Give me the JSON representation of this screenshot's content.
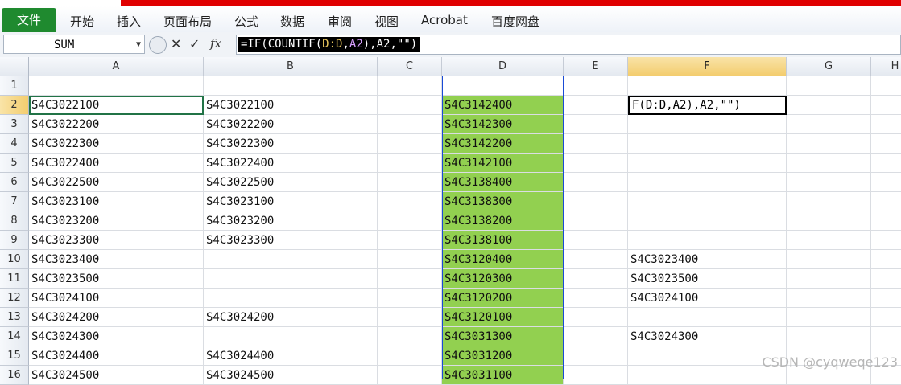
{
  "ribbon": {
    "file_tab": "文件",
    "tabs": [
      "开始",
      "插入",
      "页面布局",
      "公式",
      "数据",
      "审阅",
      "视图",
      "Acrobat",
      "百度网盘"
    ]
  },
  "formula_bar": {
    "name_box": "SUM",
    "cancel_icon": "✕",
    "enter_icon": "✓",
    "fx_icon": "fx",
    "formula_prefix": "=IF(COUNTIF(",
    "formula_ref1": "D:D",
    "formula_mid": ",",
    "formula_ref2": "A2",
    "formula_suffix": "),A2,\"\")"
  },
  "columns": [
    "A",
    "B",
    "C",
    "D",
    "E",
    "F",
    "G",
    "H"
  ],
  "rows": [
    {
      "n": "1",
      "A": "",
      "B": "",
      "D": "",
      "F": ""
    },
    {
      "n": "2",
      "A": "S4C3022100",
      "B": "S4C3022100",
      "D": "S4C3142400",
      "F": "F(D:D,A2),A2,\"\")"
    },
    {
      "n": "3",
      "A": "S4C3022200",
      "B": "S4C3022200",
      "D": "S4C3142300",
      "F": ""
    },
    {
      "n": "4",
      "A": "S4C3022300",
      "B": "S4C3022300",
      "D": "S4C3142200",
      "F": ""
    },
    {
      "n": "5",
      "A": "S4C3022400",
      "B": "S4C3022400",
      "D": "S4C3142100",
      "F": ""
    },
    {
      "n": "6",
      "A": "S4C3022500",
      "B": "S4C3022500",
      "D": "S4C3138400",
      "F": ""
    },
    {
      "n": "7",
      "A": "S4C3023100",
      "B": "S4C3023100",
      "D": "S4C3138300",
      "F": ""
    },
    {
      "n": "8",
      "A": "S4C3023200",
      "B": "S4C3023200",
      "D": "S4C3138200",
      "F": ""
    },
    {
      "n": "9",
      "A": "S4C3023300",
      "B": "S4C3023300",
      "D": "S4C3138100",
      "F": ""
    },
    {
      "n": "10",
      "A": "S4C3023400",
      "B": "",
      "D": "S4C3120400",
      "F": "S4C3023400"
    },
    {
      "n": "11",
      "A": "S4C3023500",
      "B": "",
      "D": "S4C3120300",
      "F": "S4C3023500"
    },
    {
      "n": "12",
      "A": "S4C3024100",
      "B": "",
      "D": "S4C3120200",
      "F": "S4C3024100"
    },
    {
      "n": "13",
      "A": "S4C3024200",
      "B": "S4C3024200",
      "D": "S4C3120100",
      "F": ""
    },
    {
      "n": "14",
      "A": "S4C3024300",
      "B": "",
      "D": "S4C3031300",
      "F": "S4C3024300"
    },
    {
      "n": "15",
      "A": "S4C3024400",
      "B": "S4C3024400",
      "D": "S4C3031200",
      "F": ""
    },
    {
      "n": "16",
      "A": "S4C3024500",
      "B": "S4C3024500",
      "D": "S4C3031100",
      "F": ""
    }
  ],
  "colors": {
    "highlight_green": "#92d050",
    "file_tab": "#1f8a2f",
    "accent_red": "#e00000"
  },
  "watermark": "CSDN @cyqweqe123"
}
